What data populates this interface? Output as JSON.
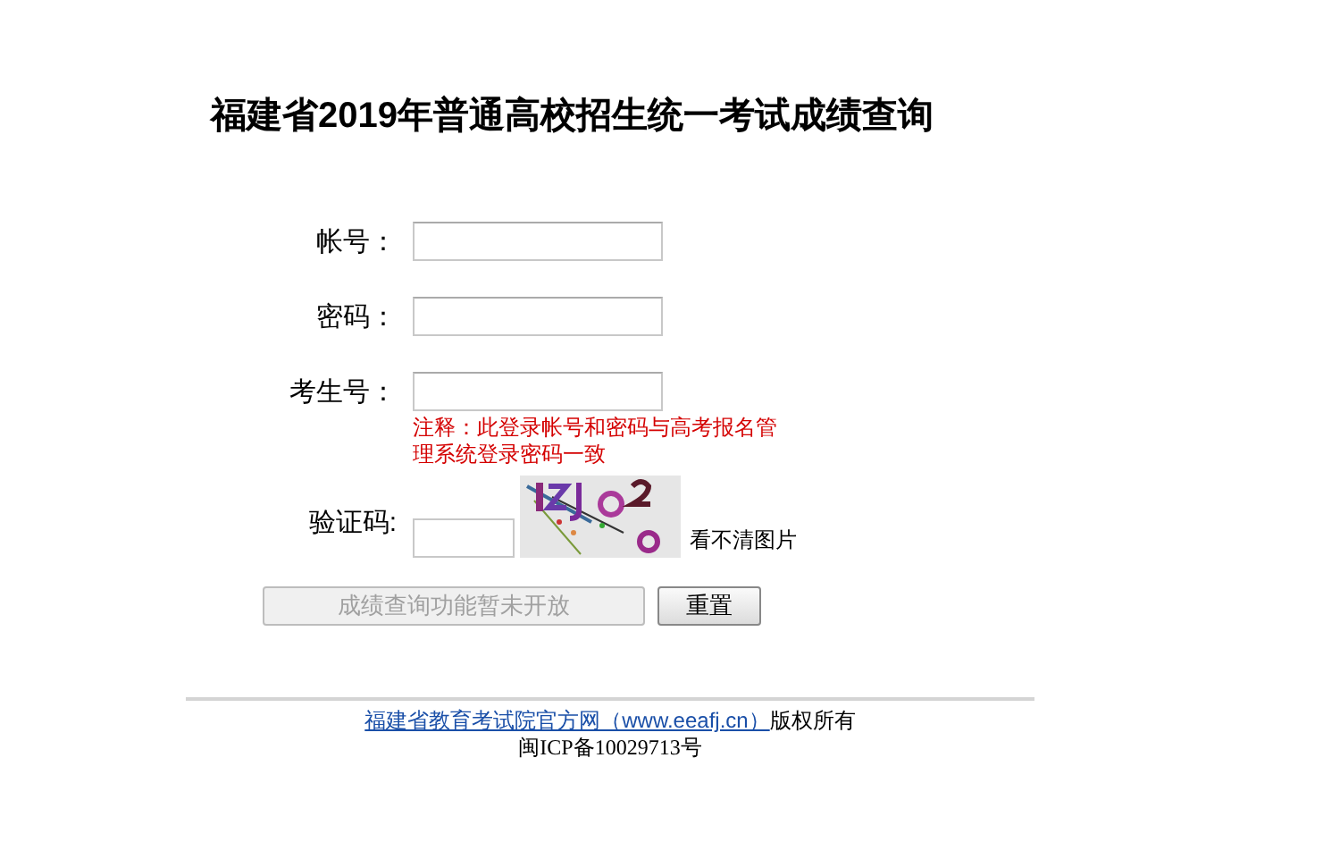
{
  "title": "福建省2019年普通高校招生统一考试成绩查询",
  "fields": [
    {
      "label": "帐号："
    },
    {
      "label": "密码："
    },
    {
      "label": "考生号："
    }
  ],
  "note": "注释：此登录帐号和密码与高考报名管理系统登录密码一致",
  "captcha": {
    "label": "验证码:",
    "refresh_link": "看不清图片"
  },
  "buttons": [
    {
      "label": "成绩查询功能暂未开放",
      "kind": "submit",
      "disabled": true
    },
    {
      "label": "重置",
      "kind": "reset",
      "disabled": false
    }
  ],
  "footer": {
    "link": "福建省教育考试院官方网（www.eeafj.cn）",
    "suffix": "版权所有",
    "icp": "闽ICP备10029713号"
  }
}
